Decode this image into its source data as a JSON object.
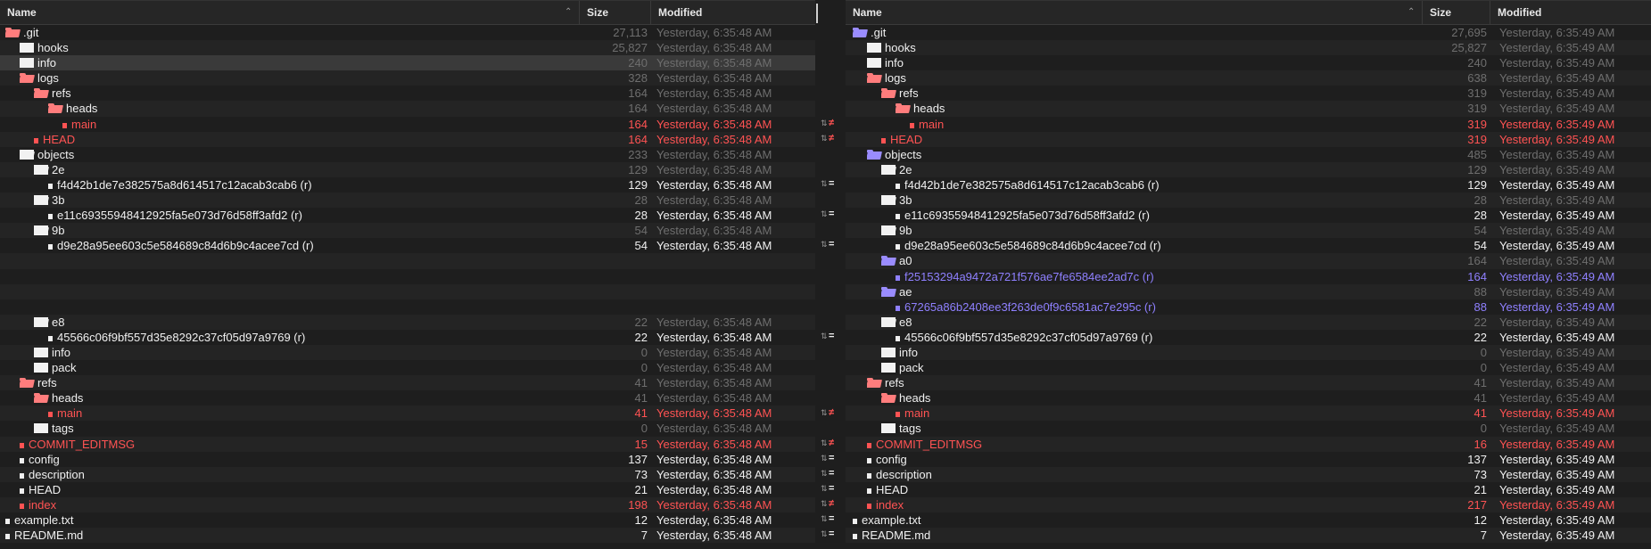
{
  "columns": {
    "name": "Name",
    "size": "Size",
    "modified": "Modified"
  },
  "left": {
    "rows": [
      {
        "depth": 0,
        "icon": "folder",
        "color": "red",
        "open": true,
        "name": ".git",
        "size": "27,113",
        "modified": "Yesterday, 6:35:48 AM",
        "status": "dim"
      },
      {
        "depth": 1,
        "icon": "folder",
        "color": "white",
        "open": false,
        "name": "hooks",
        "size": "25,827",
        "modified": "Yesterday, 6:35:48 AM",
        "status": "dim"
      },
      {
        "depth": 1,
        "icon": "folder",
        "color": "white",
        "open": false,
        "name": "info",
        "size": "240",
        "modified": "Yesterday, 6:35:48 AM",
        "status": "dim",
        "selected": true
      },
      {
        "depth": 1,
        "icon": "folder",
        "color": "red",
        "open": true,
        "name": "logs",
        "size": "328",
        "modified": "Yesterday, 6:35:48 AM",
        "status": "dim"
      },
      {
        "depth": 2,
        "icon": "folder",
        "color": "red",
        "open": true,
        "name": "refs",
        "size": "164",
        "modified": "Yesterday, 6:35:48 AM",
        "status": "dim"
      },
      {
        "depth": 3,
        "icon": "folder",
        "color": "red",
        "open": true,
        "name": "heads",
        "size": "164",
        "modified": "Yesterday, 6:35:48 AM",
        "status": "dim"
      },
      {
        "depth": 4,
        "icon": "file",
        "name": "main",
        "size": "164",
        "modified": "Yesterday, 6:35:48 AM",
        "status": "changed",
        "cmp": "≠"
      },
      {
        "depth": 2,
        "icon": "file",
        "name": "HEAD",
        "size": "164",
        "modified": "Yesterday, 6:35:48 AM",
        "status": "changed",
        "cmp": "≠"
      },
      {
        "depth": 1,
        "icon": "folder",
        "color": "white",
        "open": true,
        "name": "objects",
        "size": "233",
        "modified": "Yesterday, 6:35:48 AM",
        "status": "dim"
      },
      {
        "depth": 2,
        "icon": "folder",
        "color": "white",
        "open": true,
        "name": "2e",
        "size": "129",
        "modified": "Yesterday, 6:35:48 AM",
        "status": "dim"
      },
      {
        "depth": 3,
        "icon": "file",
        "name": "f4d42b1de7e382575a8d614517c12acab3cab6 (r)",
        "size": "129",
        "modified": "Yesterday, 6:35:48 AM",
        "status": "normal",
        "cmp": "="
      },
      {
        "depth": 2,
        "icon": "folder",
        "color": "white",
        "open": true,
        "name": "3b",
        "size": "28",
        "modified": "Yesterday, 6:35:48 AM",
        "status": "dim"
      },
      {
        "depth": 3,
        "icon": "file",
        "name": "e11c69355948412925fa5e073d76d58ff3afd2 (r)",
        "size": "28",
        "modified": "Yesterday, 6:35:48 AM",
        "status": "normal",
        "cmp": "="
      },
      {
        "depth": 2,
        "icon": "folder",
        "color": "white",
        "open": true,
        "name": "9b",
        "size": "54",
        "modified": "Yesterday, 6:35:48 AM",
        "status": "dim"
      },
      {
        "depth": 3,
        "icon": "file",
        "name": "d9e28a95ee603c5e584689c84d6b9c4acee7cd (r)",
        "size": "54",
        "modified": "Yesterday, 6:35:48 AM",
        "status": "normal",
        "cmp": "="
      },
      {
        "blank": true
      },
      {
        "blank": true
      },
      {
        "blank": true
      },
      {
        "blank": true
      },
      {
        "depth": 2,
        "icon": "folder",
        "color": "white",
        "open": true,
        "name": "e8",
        "size": "22",
        "modified": "Yesterday, 6:35:48 AM",
        "status": "dim"
      },
      {
        "depth": 3,
        "icon": "file",
        "name": "45566c06f9bf557d35e8292c37cf05d97a9769 (r)",
        "size": "22",
        "modified": "Yesterday, 6:35:48 AM",
        "status": "normal",
        "cmp": "="
      },
      {
        "depth": 2,
        "icon": "folder",
        "color": "white",
        "open": false,
        "name": "info",
        "size": "0",
        "modified": "Yesterday, 6:35:48 AM",
        "status": "dim"
      },
      {
        "depth": 2,
        "icon": "folder",
        "color": "white",
        "open": false,
        "name": "pack",
        "size": "0",
        "modified": "Yesterday, 6:35:48 AM",
        "status": "dim"
      },
      {
        "depth": 1,
        "icon": "folder",
        "color": "red",
        "open": true,
        "name": "refs",
        "size": "41",
        "modified": "Yesterday, 6:35:48 AM",
        "status": "dim"
      },
      {
        "depth": 2,
        "icon": "folder",
        "color": "red",
        "open": true,
        "name": "heads",
        "size": "41",
        "modified": "Yesterday, 6:35:48 AM",
        "status": "dim"
      },
      {
        "depth": 3,
        "icon": "file",
        "name": "main",
        "size": "41",
        "modified": "Yesterday, 6:35:48 AM",
        "status": "changed",
        "cmp": "≠"
      },
      {
        "depth": 2,
        "icon": "folder",
        "color": "white",
        "open": false,
        "name": "tags",
        "size": "0",
        "modified": "Yesterday, 6:35:48 AM",
        "status": "dim"
      },
      {
        "depth": 1,
        "icon": "file",
        "name": "COMMIT_EDITMSG",
        "size": "15",
        "modified": "Yesterday, 6:35:48 AM",
        "status": "changed",
        "cmp": "≠"
      },
      {
        "depth": 1,
        "icon": "file",
        "name": "config",
        "size": "137",
        "modified": "Yesterday, 6:35:48 AM",
        "status": "normal",
        "cmp": "="
      },
      {
        "depth": 1,
        "icon": "file",
        "name": "description",
        "size": "73",
        "modified": "Yesterday, 6:35:48 AM",
        "status": "normal",
        "cmp": "="
      },
      {
        "depth": 1,
        "icon": "file",
        "name": "HEAD",
        "size": "21",
        "modified": "Yesterday, 6:35:48 AM",
        "status": "normal",
        "cmp": "="
      },
      {
        "depth": 1,
        "icon": "file",
        "name": "index",
        "size": "198",
        "modified": "Yesterday, 6:35:48 AM",
        "status": "changed",
        "cmp": "≠"
      },
      {
        "depth": 0,
        "icon": "file",
        "name": "example.txt",
        "size": "12",
        "modified": "Yesterday, 6:35:48 AM",
        "status": "normal",
        "cmp": "="
      },
      {
        "depth": 0,
        "icon": "file",
        "name": "README.md",
        "size": "7",
        "modified": "Yesterday, 6:35:48 AM",
        "status": "normal",
        "cmp": "="
      }
    ]
  },
  "right": {
    "rows": [
      {
        "depth": 0,
        "icon": "folder",
        "color": "purple",
        "open": true,
        "name": ".git",
        "size": "27,695",
        "modified": "Yesterday, 6:35:49 AM",
        "status": "dim"
      },
      {
        "depth": 1,
        "icon": "folder",
        "color": "white",
        "open": false,
        "name": "hooks",
        "size": "25,827",
        "modified": "Yesterday, 6:35:49 AM",
        "status": "dim"
      },
      {
        "depth": 1,
        "icon": "folder",
        "color": "white",
        "open": false,
        "name": "info",
        "size": "240",
        "modified": "Yesterday, 6:35:49 AM",
        "status": "dim"
      },
      {
        "depth": 1,
        "icon": "folder",
        "color": "red",
        "open": true,
        "name": "logs",
        "size": "638",
        "modified": "Yesterday, 6:35:49 AM",
        "status": "dim"
      },
      {
        "depth": 2,
        "icon": "folder",
        "color": "red",
        "open": true,
        "name": "refs",
        "size": "319",
        "modified": "Yesterday, 6:35:49 AM",
        "status": "dim"
      },
      {
        "depth": 3,
        "icon": "folder",
        "color": "red",
        "open": true,
        "name": "heads",
        "size": "319",
        "modified": "Yesterday, 6:35:49 AM",
        "status": "dim"
      },
      {
        "depth": 4,
        "icon": "file",
        "name": "main",
        "size": "319",
        "modified": "Yesterday, 6:35:49 AM",
        "status": "changed"
      },
      {
        "depth": 2,
        "icon": "file",
        "name": "HEAD",
        "size": "319",
        "modified": "Yesterday, 6:35:49 AM",
        "status": "changed"
      },
      {
        "depth": 1,
        "icon": "folder",
        "color": "purple",
        "open": true,
        "name": "objects",
        "size": "485",
        "modified": "Yesterday, 6:35:49 AM",
        "status": "dim"
      },
      {
        "depth": 2,
        "icon": "folder",
        "color": "white",
        "open": true,
        "name": "2e",
        "size": "129",
        "modified": "Yesterday, 6:35:49 AM",
        "status": "dim"
      },
      {
        "depth": 3,
        "icon": "file",
        "name": "f4d42b1de7e382575a8d614517c12acab3cab6 (r)",
        "size": "129",
        "modified": "Yesterday, 6:35:49 AM",
        "status": "normal"
      },
      {
        "depth": 2,
        "icon": "folder",
        "color": "white",
        "open": true,
        "name": "3b",
        "size": "28",
        "modified": "Yesterday, 6:35:49 AM",
        "status": "dim"
      },
      {
        "depth": 3,
        "icon": "file",
        "name": "e11c69355948412925fa5e073d76d58ff3afd2 (r)",
        "size": "28",
        "modified": "Yesterday, 6:35:49 AM",
        "status": "normal"
      },
      {
        "depth": 2,
        "icon": "folder",
        "color": "white",
        "open": true,
        "name": "9b",
        "size": "54",
        "modified": "Yesterday, 6:35:49 AM",
        "status": "dim"
      },
      {
        "depth": 3,
        "icon": "file",
        "name": "d9e28a95ee603c5e584689c84d6b9c4acee7cd (r)",
        "size": "54",
        "modified": "Yesterday, 6:35:49 AM",
        "status": "normal"
      },
      {
        "depth": 2,
        "icon": "folder",
        "color": "purple",
        "open": true,
        "name": "a0",
        "size": "164",
        "modified": "Yesterday, 6:35:49 AM",
        "status": "dim"
      },
      {
        "depth": 3,
        "icon": "file",
        "name": "f25153294a9472a721f576ae7fe6584ee2ad7c (r)",
        "size": "164",
        "modified": "Yesterday, 6:35:49 AM",
        "status": "added"
      },
      {
        "depth": 2,
        "icon": "folder",
        "color": "purple",
        "open": true,
        "name": "ae",
        "size": "88",
        "modified": "Yesterday, 6:35:49 AM",
        "status": "dim"
      },
      {
        "depth": 3,
        "icon": "file",
        "name": "67265a86b2408ee3f263de0f9c6581ac7e295c (r)",
        "size": "88",
        "modified": "Yesterday, 6:35:49 AM",
        "status": "added"
      },
      {
        "depth": 2,
        "icon": "folder",
        "color": "white",
        "open": true,
        "name": "e8",
        "size": "22",
        "modified": "Yesterday, 6:35:49 AM",
        "status": "dim"
      },
      {
        "depth": 3,
        "icon": "file",
        "name": "45566c06f9bf557d35e8292c37cf05d97a9769 (r)",
        "size": "22",
        "modified": "Yesterday, 6:35:49 AM",
        "status": "normal"
      },
      {
        "depth": 2,
        "icon": "folder",
        "color": "white",
        "open": false,
        "name": "info",
        "size": "0",
        "modified": "Yesterday, 6:35:49 AM",
        "status": "dim"
      },
      {
        "depth": 2,
        "icon": "folder",
        "color": "white",
        "open": false,
        "name": "pack",
        "size": "0",
        "modified": "Yesterday, 6:35:49 AM",
        "status": "dim"
      },
      {
        "depth": 1,
        "icon": "folder",
        "color": "red",
        "open": true,
        "name": "refs",
        "size": "41",
        "modified": "Yesterday, 6:35:49 AM",
        "status": "dim"
      },
      {
        "depth": 2,
        "icon": "folder",
        "color": "red",
        "open": true,
        "name": "heads",
        "size": "41",
        "modified": "Yesterday, 6:35:49 AM",
        "status": "dim"
      },
      {
        "depth": 3,
        "icon": "file",
        "name": "main",
        "size": "41",
        "modified": "Yesterday, 6:35:49 AM",
        "status": "changed"
      },
      {
        "depth": 2,
        "icon": "folder",
        "color": "white",
        "open": false,
        "name": "tags",
        "size": "0",
        "modified": "Yesterday, 6:35:49 AM",
        "status": "dim"
      },
      {
        "depth": 1,
        "icon": "file",
        "name": "COMMIT_EDITMSG",
        "size": "16",
        "modified": "Yesterday, 6:35:49 AM",
        "status": "changed"
      },
      {
        "depth": 1,
        "icon": "file",
        "name": "config",
        "size": "137",
        "modified": "Yesterday, 6:35:49 AM",
        "status": "normal"
      },
      {
        "depth": 1,
        "icon": "file",
        "name": "description",
        "size": "73",
        "modified": "Yesterday, 6:35:49 AM",
        "status": "normal"
      },
      {
        "depth": 1,
        "icon": "file",
        "name": "HEAD",
        "size": "21",
        "modified": "Yesterday, 6:35:49 AM",
        "status": "normal"
      },
      {
        "depth": 1,
        "icon": "file",
        "name": "index",
        "size": "217",
        "modified": "Yesterday, 6:35:49 AM",
        "status": "changed"
      },
      {
        "depth": 0,
        "icon": "file",
        "name": "example.txt",
        "size": "12",
        "modified": "Yesterday, 6:35:49 AM",
        "status": "normal"
      },
      {
        "depth": 0,
        "icon": "file",
        "name": "README.md",
        "size": "7",
        "modified": "Yesterday, 6:35:49 AM",
        "status": "normal"
      }
    ]
  },
  "colors": {
    "changed": "#ff5353",
    "added": "#8f80ff",
    "dim": "#6e6e6e",
    "normal": "#f0f0f0"
  }
}
